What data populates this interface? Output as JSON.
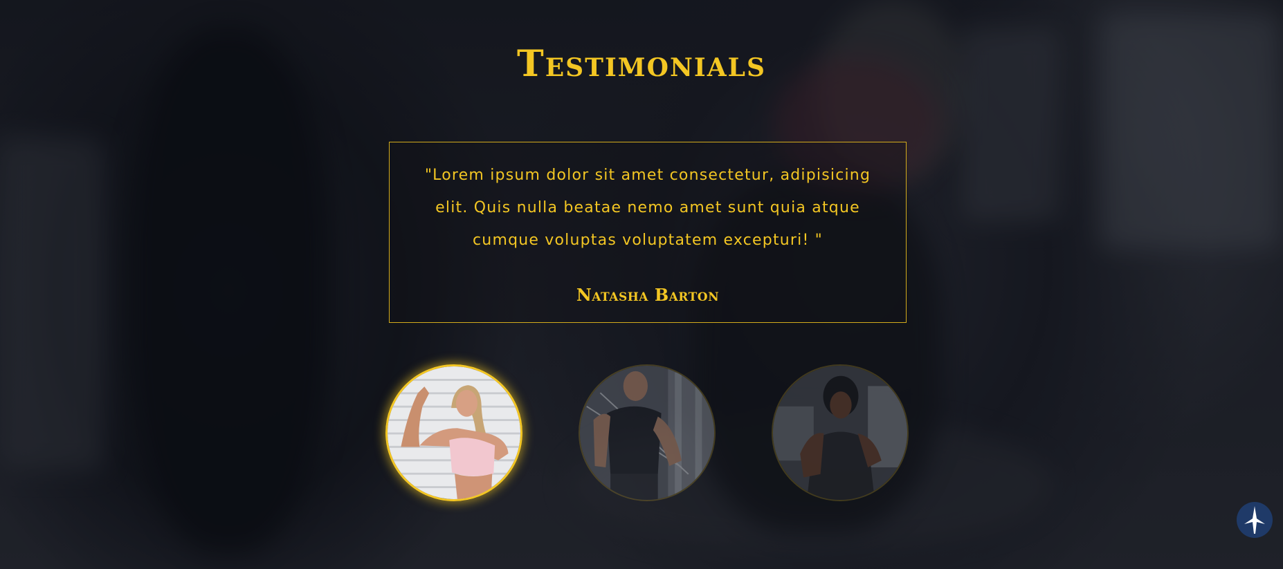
{
  "section": {
    "title": "Testimonials"
  },
  "testimonial": {
    "quote": "\"Lorem ipsum dolor sit amet consectetur, adipisicing elit. Quis nulla beatae nemo amet sunt quia atque cumque voluptas voluptatem excepturi! \"",
    "author": "Natasha Barton"
  },
  "avatars": [
    {
      "icon": "woman-flexing-photo",
      "active": true
    },
    {
      "icon": "man-cable-workout-photo",
      "active": false
    },
    {
      "icon": "woman-gym-photo",
      "active": false
    }
  ],
  "back_to_top": {
    "icon": "arrow-up-icon"
  },
  "colors": {
    "accent": "#f3c623",
    "button_bg": "#1f3a68",
    "background": "#1a1c24"
  }
}
